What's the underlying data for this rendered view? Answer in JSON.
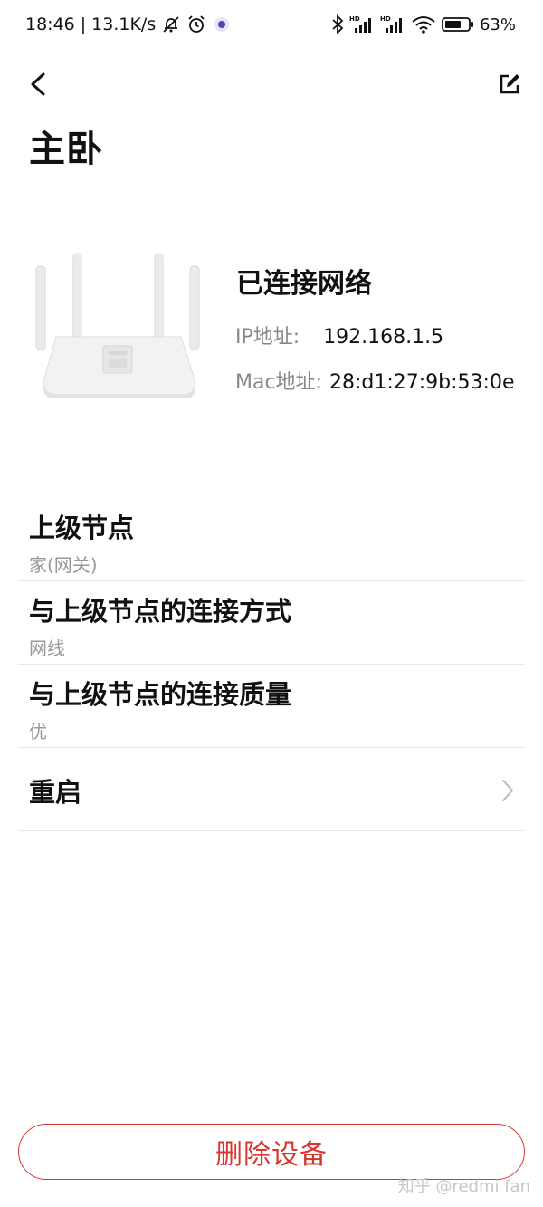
{
  "status_bar": {
    "time": "18:46",
    "separator": "|",
    "net_speed": "13.1K/s",
    "battery_percent": "63%",
    "icons": [
      "mute-bell-icon",
      "alarm-icon",
      "app-notification-icon",
      "bluetooth-icon",
      "signal-hd-icon",
      "signal-hd-icon",
      "wifi-icon",
      "battery-icon"
    ]
  },
  "header": {
    "back_icon": "chevron-left-icon",
    "edit_icon": "edit-icon",
    "title": "主卧"
  },
  "device": {
    "image": "router-icon",
    "status": "已连接网络",
    "ip_label": "IP地址:",
    "ip_value": "192.168.1.5",
    "mac_label": "Mac地址:",
    "mac_value": "28:d1:27:9b:53:0e"
  },
  "list": {
    "items": [
      {
        "title": "上级节点",
        "subtitle": "家(网关)"
      },
      {
        "title": "与上级节点的连接方式",
        "subtitle": "网线"
      },
      {
        "title": "与上级节点的连接质量",
        "subtitle": "优"
      },
      {
        "title": "重启",
        "icon": "chevron-right-icon"
      }
    ]
  },
  "delete_button": {
    "label": "删除设备"
  },
  "watermark": "知乎 @redmi fan",
  "colors": {
    "accent_red": "#d9352e",
    "text_primary": "#111111",
    "text_secondary": "#888888",
    "divider": "#e8e8e8"
  }
}
